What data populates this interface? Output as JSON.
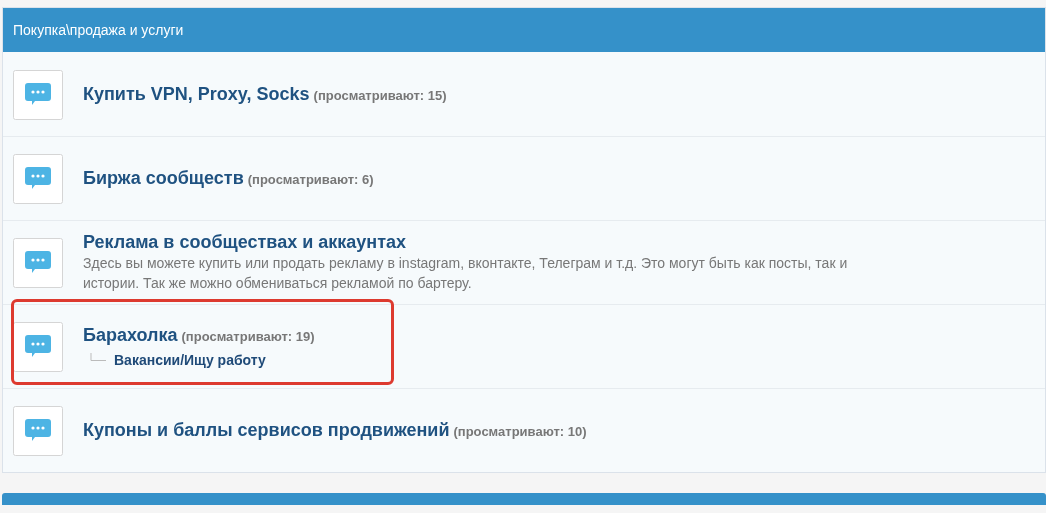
{
  "category": {
    "title": "Покупка\\продажа и услуги"
  },
  "forums": [
    {
      "title": "Купить VPN, Proxy, Socks",
      "viewers": "(просматривают: 15)",
      "highlighted": false
    },
    {
      "title": "Биржа сообществ",
      "viewers": "(просматривают: 6)",
      "highlighted": false
    },
    {
      "title": "Реклама в сообществах и аккаунтах",
      "description": "Здесь вы можете купить или продать рекламу в instagram, вконтакте, Телеграм и т.д. Это могут быть как посты, так и истории. Так же можно обмениваться рекламой по бартеру.",
      "highlighted": false
    },
    {
      "title": "Барахолка",
      "viewers": "(просматривают: 19)",
      "highlighted": true,
      "subforums": [
        "Вакансии/Ищу работу"
      ]
    },
    {
      "title": "Купоны и баллы сервисов продвижений",
      "viewers": "(просматривают: 10)",
      "highlighted": false
    }
  ]
}
